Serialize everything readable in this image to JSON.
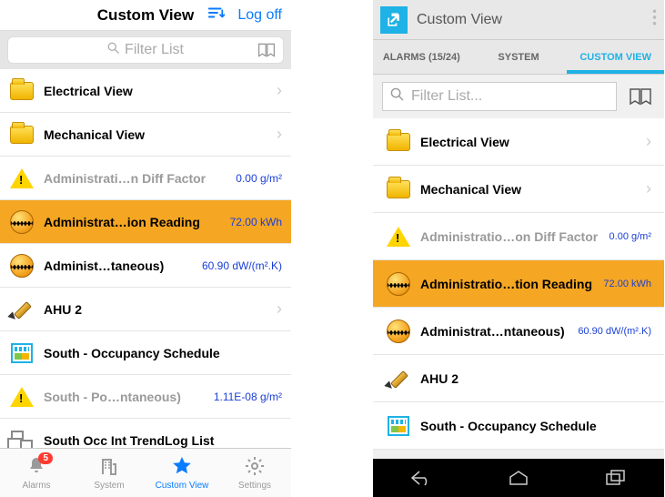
{
  "ios": {
    "header": {
      "title": "Custom View",
      "logoff": "Log off"
    },
    "search": {
      "placeholder": "Filter List"
    },
    "rows": [
      {
        "label": "Electrical View",
        "labelGrey": false,
        "value": "",
        "chevron": true,
        "icon": "folder"
      },
      {
        "label": "Mechanical View",
        "labelGrey": false,
        "value": "",
        "chevron": true,
        "icon": "folder"
      },
      {
        "label": "Administrati…n Diff Factor",
        "labelGrey": true,
        "value": "0.00 g/m²",
        "chevron": false,
        "icon": "warn"
      },
      {
        "label": "Administrat…ion Reading",
        "labelGrey": false,
        "value": "72.00 kWh",
        "chevron": false,
        "icon": "wave",
        "selected": true
      },
      {
        "label": "Administ…taneous)",
        "labelGrey": false,
        "value": "60.90 dW/(m².K)",
        "chevron": false,
        "icon": "wave"
      },
      {
        "label": "AHU 2",
        "labelGrey": false,
        "value": "",
        "chevron": true,
        "icon": "pen"
      },
      {
        "label": "South - Occupancy Schedule",
        "labelGrey": false,
        "value": "",
        "chevron": false,
        "icon": "cal"
      },
      {
        "label": "South - Po…ntaneous)",
        "labelGrey": true,
        "value": "1.11E-08 g/m²",
        "chevron": false,
        "icon": "warn"
      },
      {
        "label": "South Occ Int TrendLog List",
        "labelGrey": false,
        "value": "",
        "chevron": false,
        "icon": "tree"
      }
    ],
    "tabs": {
      "alarms": "Alarms",
      "alarms_badge": "5",
      "system": "System",
      "custom": "Custom View",
      "settings": "Settings"
    }
  },
  "android": {
    "header": {
      "title": "Custom View"
    },
    "tabs": {
      "alarms": "ALARMS (15/24)",
      "system": "SYSTEM",
      "custom": "CUSTOM VIEW"
    },
    "search": {
      "placeholder": "Filter List..."
    },
    "rows": [
      {
        "label": "Electrical View",
        "labelGrey": false,
        "value": "",
        "chevron": true,
        "icon": "folder"
      },
      {
        "label": "Mechanical View",
        "labelGrey": false,
        "value": "",
        "chevron": true,
        "icon": "folder"
      },
      {
        "label": "Administratio…on Diff Factor",
        "labelGrey": true,
        "value": "0.00 g/m²",
        "chevron": false,
        "icon": "warn"
      },
      {
        "label": "Administratio…tion Reading",
        "labelGrey": false,
        "value": "72.00 kWh",
        "chevron": false,
        "icon": "wave",
        "selected": true
      },
      {
        "label": "Administrat…ntaneous)",
        "labelGrey": false,
        "value": "60.90 dW/(m².K)",
        "chevron": false,
        "icon": "wave"
      },
      {
        "label": "AHU 2",
        "labelGrey": false,
        "value": "",
        "chevron": false,
        "icon": "pen"
      },
      {
        "label": "South - Occupancy Schedule",
        "labelGrey": false,
        "value": "",
        "chevron": false,
        "icon": "cal"
      }
    ]
  }
}
